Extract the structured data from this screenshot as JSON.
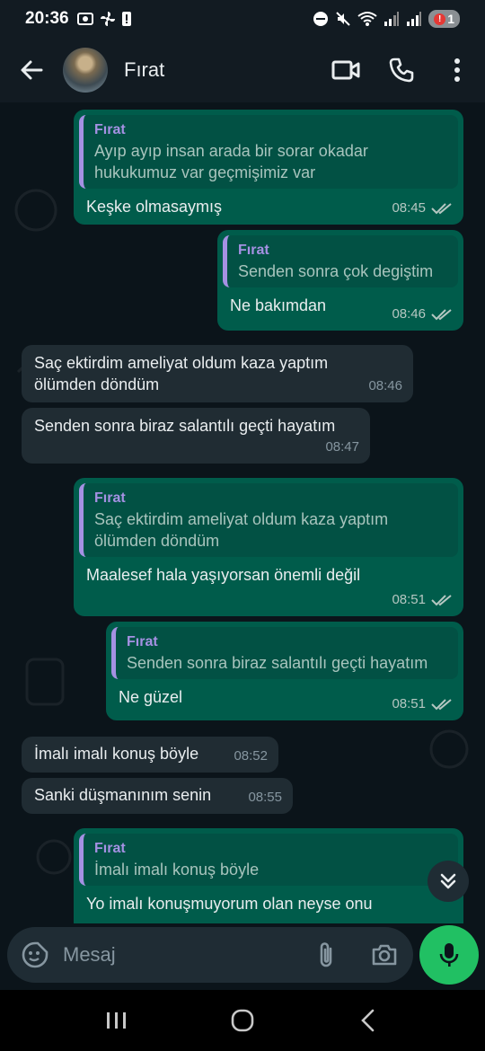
{
  "status_bar": {
    "time": "20:36",
    "battery_badge": "1"
  },
  "header": {
    "contact_name": "Fırat"
  },
  "messages": [
    {
      "dir": "out",
      "quote_name": "Fırat",
      "quote_text": "Ayıp ayıp insan arada bir sorar okadar hukukumuz var geçmişimiz var",
      "text": "Keşke olmasaymış",
      "time": "08:45"
    },
    {
      "dir": "out",
      "quote_name": "Fırat",
      "quote_text": "Senden sonra çok degiştim",
      "text": "Ne bakımdan",
      "time": "08:46"
    },
    {
      "dir": "in",
      "text": "Saç ektirdim ameliyat oldum  kaza yaptım ölümden döndüm",
      "time": "08:46"
    },
    {
      "dir": "in",
      "text": "Senden sonra biraz salantılı geçti hayatım",
      "time": "08:47"
    },
    {
      "dir": "out",
      "quote_name": "Fırat",
      "quote_text": "Saç ektirdim ameliyat oldum  kaza yaptım ölümden döndüm",
      "text": "Maalesef hala yaşıyorsan önemli değil",
      "time": "08:51"
    },
    {
      "dir": "out",
      "quote_name": "Fırat",
      "quote_text": "Senden sonra biraz salantılı geçti hayatım",
      "text": "Ne güzel",
      "time": "08:51"
    },
    {
      "dir": "in",
      "text": "İmalı imalı konuş böyle",
      "time": "08:52"
    },
    {
      "dir": "in",
      "text": "Sanki düşmanınım senin",
      "time": "08:55"
    },
    {
      "dir": "out",
      "quote_name": "Fırat",
      "quote_text": "İmalı imalı konuş böyle",
      "text": "Yo imalı konuşmuyorum olan neyse onu",
      "time": ""
    }
  ],
  "composer": {
    "placeholder": "Mesaj"
  },
  "colors": {
    "outgoing": "#005c4b",
    "incoming": "#202c33",
    "accent": "#21c063",
    "quote_name": "#a591e3"
  },
  "icons": [
    "back-arrow-icon",
    "video-call-icon",
    "phone-icon",
    "more-vert-icon",
    "emoji-sticker-icon",
    "attach-icon",
    "camera-icon",
    "mic-icon",
    "double-chevron-down-icon"
  ]
}
